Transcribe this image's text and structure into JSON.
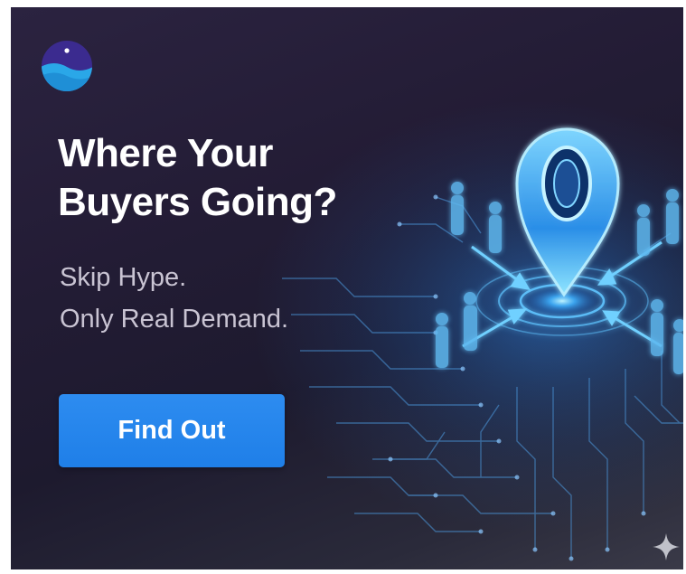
{
  "ad": {
    "headline_line1": "Where Your",
    "headline_line2": "Buyers Going?",
    "subhead_line1": "Skip Hype.",
    "subhead_line2": "Only Real Demand.",
    "cta_label": "Find Out"
  },
  "icons": {
    "logo": "brand-logo",
    "illustration": "location-pin-circuit-illustration",
    "corner": "sparkle-icon"
  },
  "colors": {
    "background": "#231c35",
    "cta": "#2387ee",
    "pin_glow": "#49b8ff",
    "logo_purple": "#3b2b8f",
    "logo_blue": "#2aa7e8"
  }
}
